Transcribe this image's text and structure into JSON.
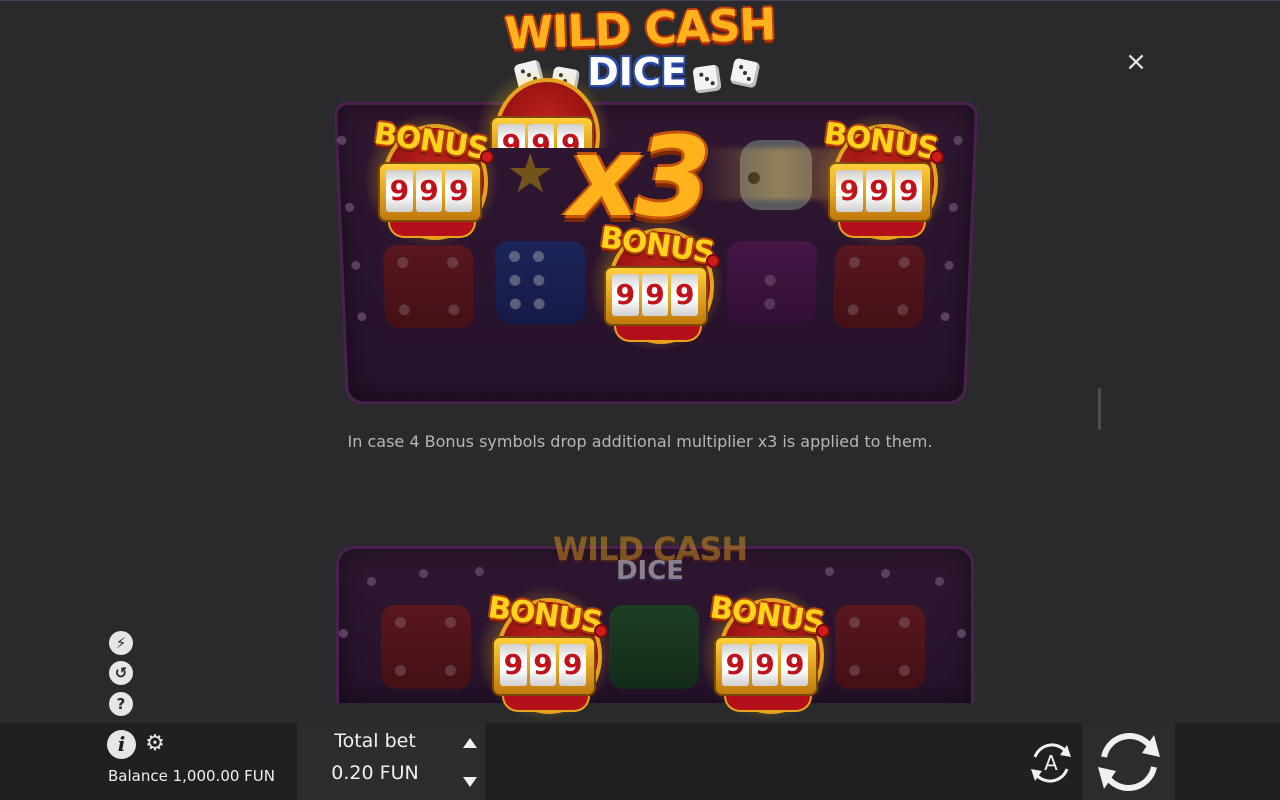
{
  "logo": {
    "line1": "WILD CASH",
    "line2": "DICE"
  },
  "close_glyph": "×",
  "illustration1": {
    "bonus_word": "BONUS",
    "reel_digit": "9",
    "multiplier": "x3"
  },
  "caption": "In case 4 Bonus symbols drop additional multiplier x3 is applied to them.",
  "illustration2": {
    "logo_line1": "WILD CASH",
    "logo_line2": "DICE",
    "bonus_word": "BONUS",
    "reel_digit": "9"
  },
  "side_icons": [
    {
      "name": "turbo-icon",
      "glyph": "⚡"
    },
    {
      "name": "history-icon",
      "glyph": "↺"
    },
    {
      "name": "help-icon",
      "glyph": "?"
    }
  ],
  "bottom_bar": {
    "info_glyph": "i",
    "gear_glyph": "⚙",
    "balance_label": "Balance",
    "balance_value": "1,000.00 FUN",
    "total_bet_label": "Total bet",
    "total_bet_value": "0.20 FUN",
    "autoplay_letter": "A"
  },
  "colors": {
    "background": "#2a2a2c",
    "bottom_bar": "#202022",
    "panel": "#2c2c2e",
    "logo_gold": "#ffb21c",
    "bonus_red": "#c0121a"
  }
}
